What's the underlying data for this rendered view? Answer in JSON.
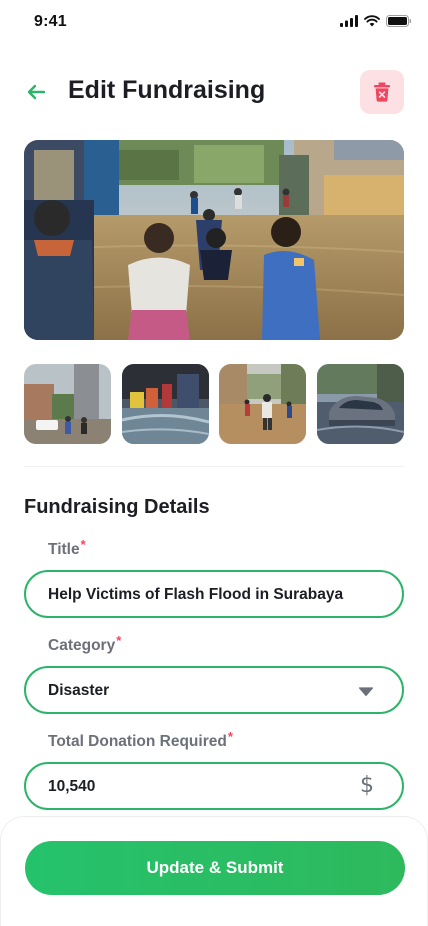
{
  "status_bar": {
    "time": "9:41"
  },
  "header": {
    "title": "Edit Fundraising"
  },
  "section_title": "Fundraising Details",
  "form": {
    "title": {
      "label": "Title",
      "required_mark": "*",
      "value": "Help Victims of Flash Flood in Surabaya"
    },
    "category": {
      "label": "Category",
      "required_mark": "*",
      "value": "Disaster"
    },
    "total": {
      "label": "Total Donation Required",
      "required_mark": "*",
      "value": "10,540",
      "currency_symbol": "$"
    }
  },
  "submit_label": "Update & Submit",
  "colors": {
    "accent": "#2cb56a",
    "danger_bg": "#fde0e4",
    "danger": "#f0455f"
  }
}
